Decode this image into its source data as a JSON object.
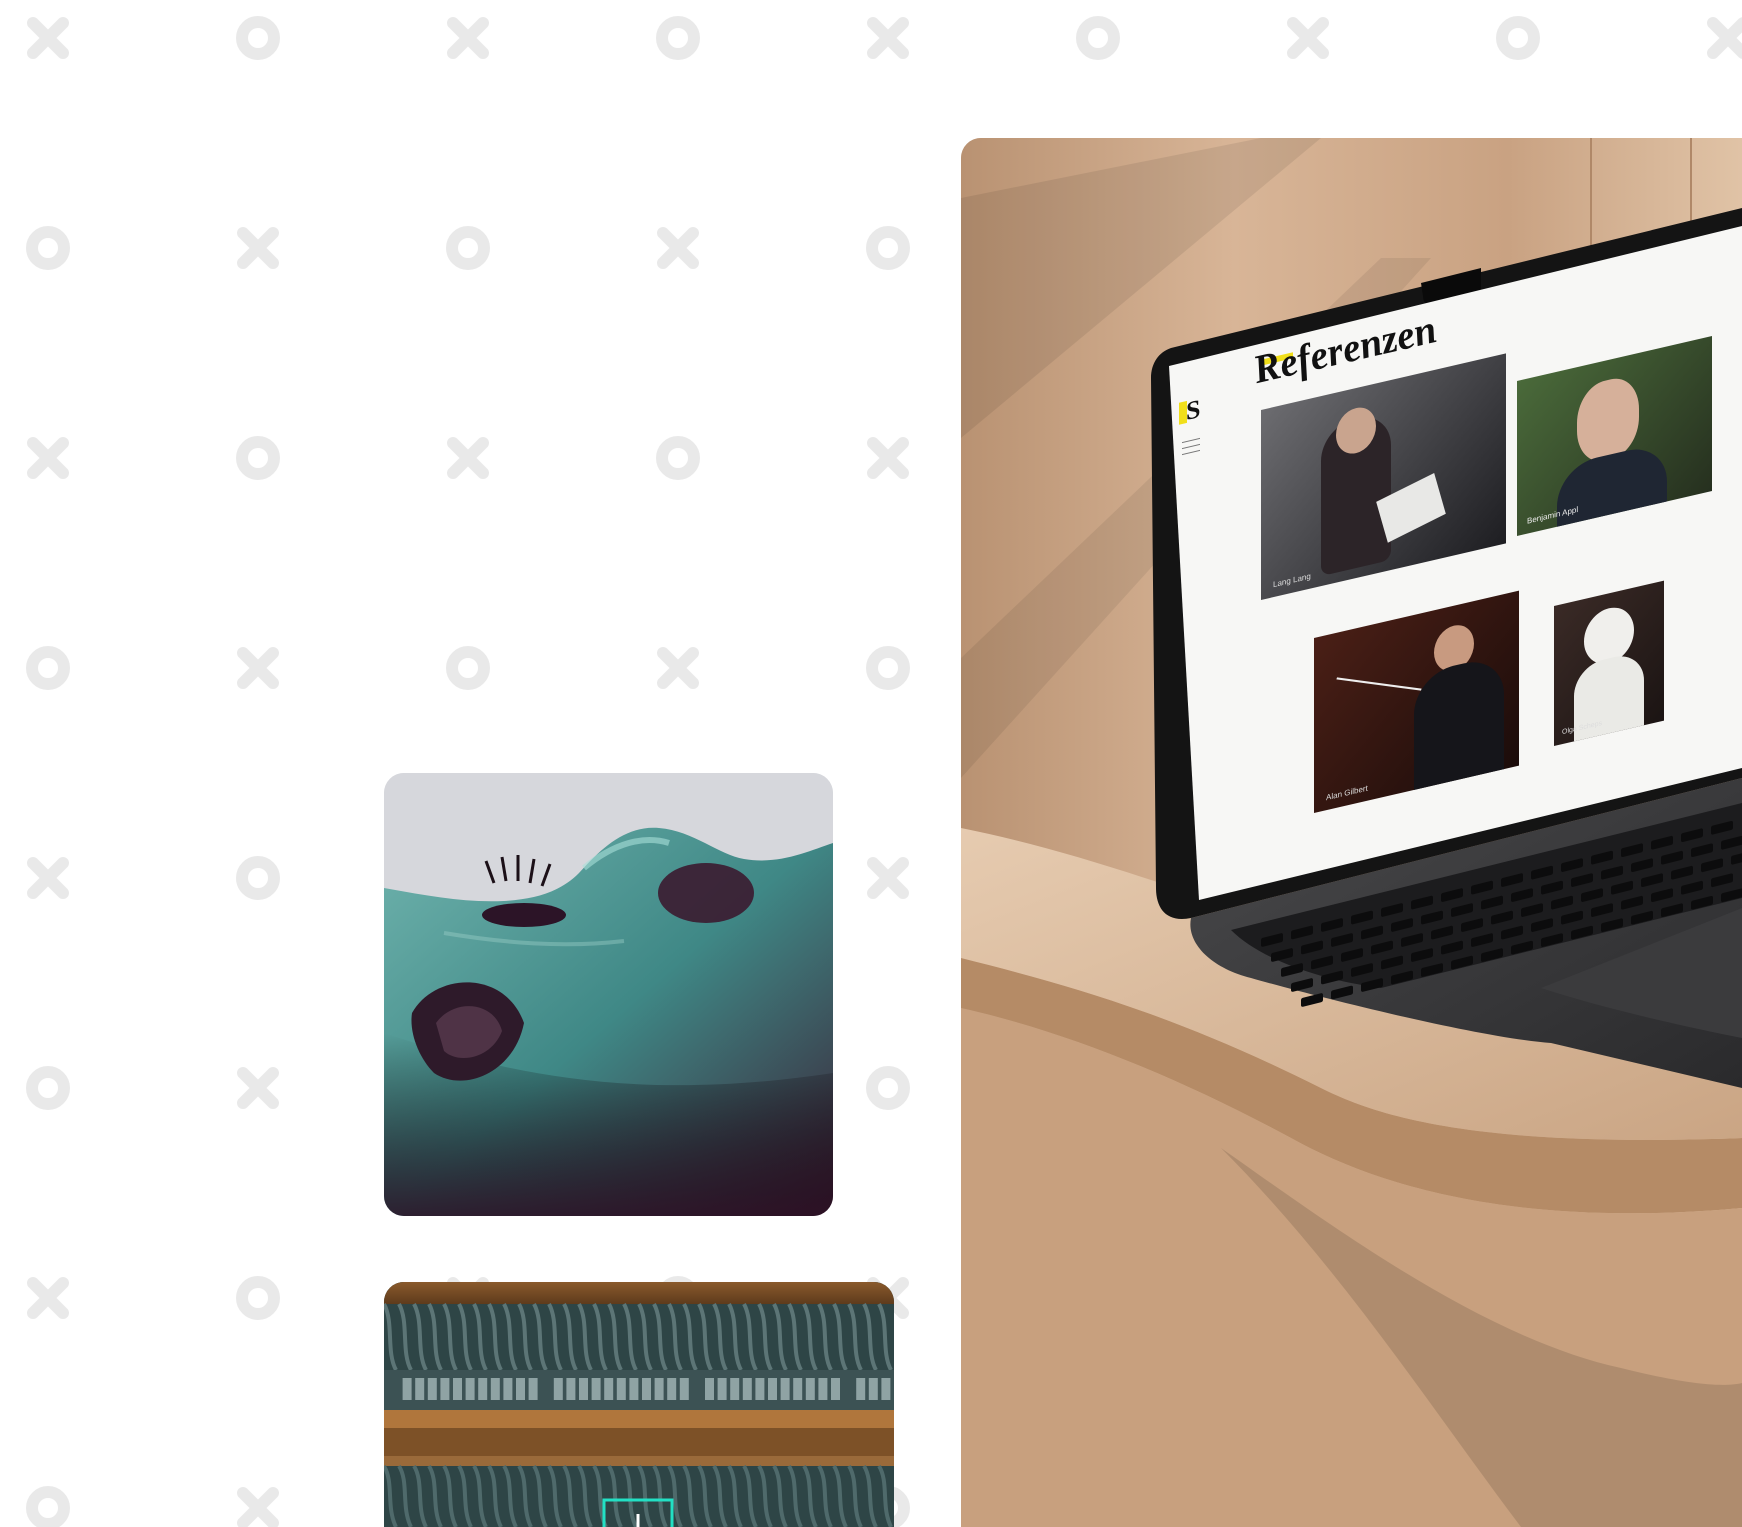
{
  "page": {
    "background_color": "#ffffff",
    "pattern_color": "#e9e9e9"
  },
  "gallery": {
    "face_image": {
      "icon": "face-closeup-image"
    },
    "theatre_image": {
      "icon": "concert-hall-image"
    },
    "laptop_image": {
      "icon": "laptop-mockup-image"
    }
  },
  "laptop_screen": {
    "logo_letter": "S",
    "heading": "Referenzen",
    "menu_icon": "hamburger-icon",
    "accent_color": "#f1df1a",
    "photos": [
      {
        "caption": "Lang Lang"
      },
      {
        "caption": "Benjamin Appl"
      },
      {
        "caption": "Alan Gilbert"
      },
      {
        "caption": "Olga Scheps"
      }
    ]
  }
}
